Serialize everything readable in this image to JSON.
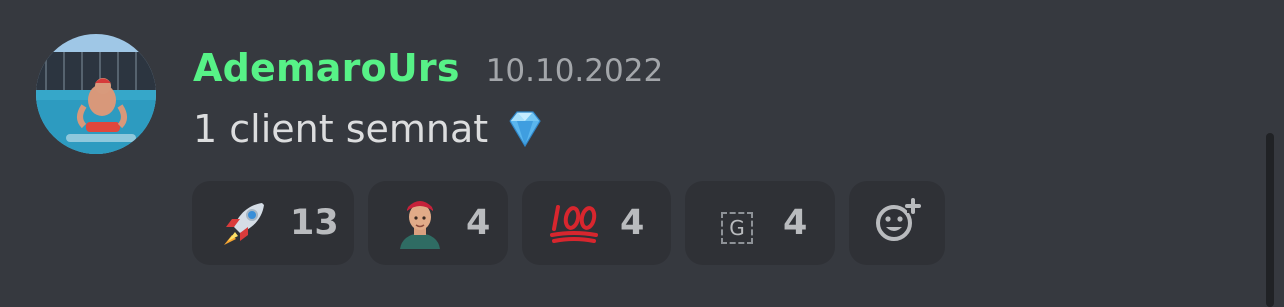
{
  "message": {
    "author": "AdemaroUrs",
    "timestamp": "10.10.2022",
    "text": "1 client semnat",
    "author_color": "#57f287",
    "inline_emoji": "gem-icon"
  },
  "reactions": [
    {
      "emoji": "rocket-icon",
      "count": "13"
    },
    {
      "emoji": "custom-avatar-emoji",
      "count": "4"
    },
    {
      "emoji": "hundred-points-icon",
      "count": "4"
    },
    {
      "emoji": "G",
      "count": "4"
    }
  ],
  "add_reaction": {
    "icon": "add-reaction-icon"
  }
}
